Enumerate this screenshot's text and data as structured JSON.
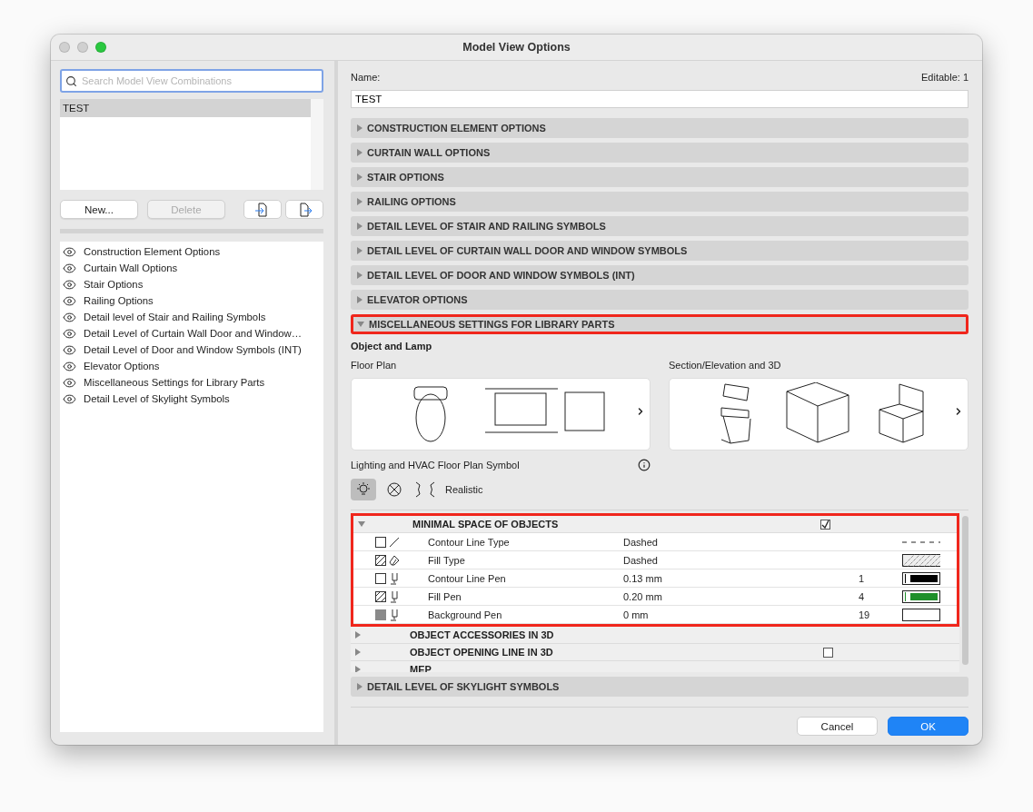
{
  "window": {
    "title": "Model View Options"
  },
  "sidebar": {
    "search": {
      "placeholder": "Search Model View Combinations"
    },
    "combinations": [
      {
        "label": "TEST",
        "selected": true
      }
    ],
    "buttons": [
      {
        "label": "New...",
        "disabled": false
      },
      {
        "label": "Delete",
        "disabled": true
      }
    ],
    "option_sets": [
      {
        "label": "Construction Element Options",
        "visible": true
      },
      {
        "label": "Curtain Wall Options",
        "visible": true
      },
      {
        "label": "Stair Options",
        "visible": true
      },
      {
        "label": "Railing Options",
        "visible": true
      },
      {
        "label": "Detail level of Stair and Railing Symbols",
        "visible": true
      },
      {
        "label": "Detail Level of Curtain Wall Door and Window…",
        "visible": true
      },
      {
        "label": "Detail Level of Door and Window Symbols (INT)",
        "visible": true
      },
      {
        "label": "Elevator Options",
        "visible": true
      },
      {
        "label": "Miscellaneous Settings for Library Parts",
        "visible": true
      },
      {
        "label": "Detail Level of Skylight Symbols",
        "visible": true
      }
    ]
  },
  "name_label": "Name:",
  "editable": "Editable: 1",
  "name_value": "TEST",
  "sections": [
    {
      "title": "CONSTRUCTION ELEMENT OPTIONS",
      "expanded": false,
      "highlighted": false
    },
    {
      "title": "CURTAIN WALL OPTIONS",
      "expanded": false,
      "highlighted": false
    },
    {
      "title": "STAIR OPTIONS",
      "expanded": false,
      "highlighted": false
    },
    {
      "title": "RAILING OPTIONS",
      "expanded": false,
      "highlighted": false
    },
    {
      "title": "DETAIL LEVEL OF STAIR AND RAILING SYMBOLS",
      "expanded": false,
      "highlighted": false
    },
    {
      "title": "DETAIL LEVEL OF CURTAIN WALL DOOR AND WINDOW SYMBOLS",
      "expanded": false,
      "highlighted": false
    },
    {
      "title": "DETAIL LEVEL OF DOOR AND WINDOW SYMBOLS (INT)",
      "expanded": false,
      "highlighted": false
    },
    {
      "title": "ELEVATOR OPTIONS",
      "expanded": false,
      "highlighted": false
    },
    {
      "title": "MISCELLANEOUS SETTINGS FOR LIBRARY PARTS",
      "expanded": true,
      "highlighted": true,
      "content": {
        "heading": "Object and Lamp",
        "previews": [
          {
            "label": "Floor Plan",
            "kind": "plan"
          },
          {
            "label": "Section/Elevation and 3D",
            "kind": "model"
          }
        ],
        "symbol": {
          "label": "Lighting and HVAC Floor Plan Symbol",
          "options": [
            {
              "kind": "bulb",
              "selected": true
            },
            {
              "kind": "cross",
              "selected": false
            },
            {
              "kind": "realistic",
              "selected": false
            }
          ],
          "caption": "Realistic"
        },
        "groups": [
          {
            "title": "MINIMAL SPACE OF OBJECTS",
            "expanded": true,
            "highlighted": true,
            "checked": true,
            "rows": [
              {
                "kind": "linetype",
                "name": "Contour Line Type",
                "value": "Dashed"
              },
              {
                "kind": "filltype",
                "name": "Fill Type",
                "value": "Dashed"
              },
              {
                "kind": "contourpen",
                "name": "Contour Line Pen",
                "value": "0.13 mm",
                "pen": "1",
                "color": "#000000"
              },
              {
                "kind": "fillpen",
                "name": "Fill Pen",
                "value": "0.20 mm",
                "pen": "4",
                "color": "#1e8f2a"
              },
              {
                "kind": "backgroundpen",
                "name": "Background Pen",
                "value": "0 mm",
                "pen": "19",
                "color": "#ffffff"
              }
            ]
          },
          {
            "title": "OBJECT ACCESSORIES IN 3D",
            "expanded": false,
            "highlighted": false
          },
          {
            "title": "OBJECT OPENING LINE IN 3D",
            "expanded": false,
            "highlighted": false,
            "checked": false
          },
          {
            "title": "MEP",
            "expanded": false,
            "highlighted": false
          }
        ]
      }
    },
    {
      "title": "DETAIL LEVEL OF SKYLIGHT SYMBOLS",
      "expanded": false,
      "highlighted": false
    }
  ],
  "footer": {
    "buttons": [
      {
        "label": "Cancel",
        "kind": "secondary"
      },
      {
        "label": "OK",
        "kind": "primary"
      }
    ]
  }
}
